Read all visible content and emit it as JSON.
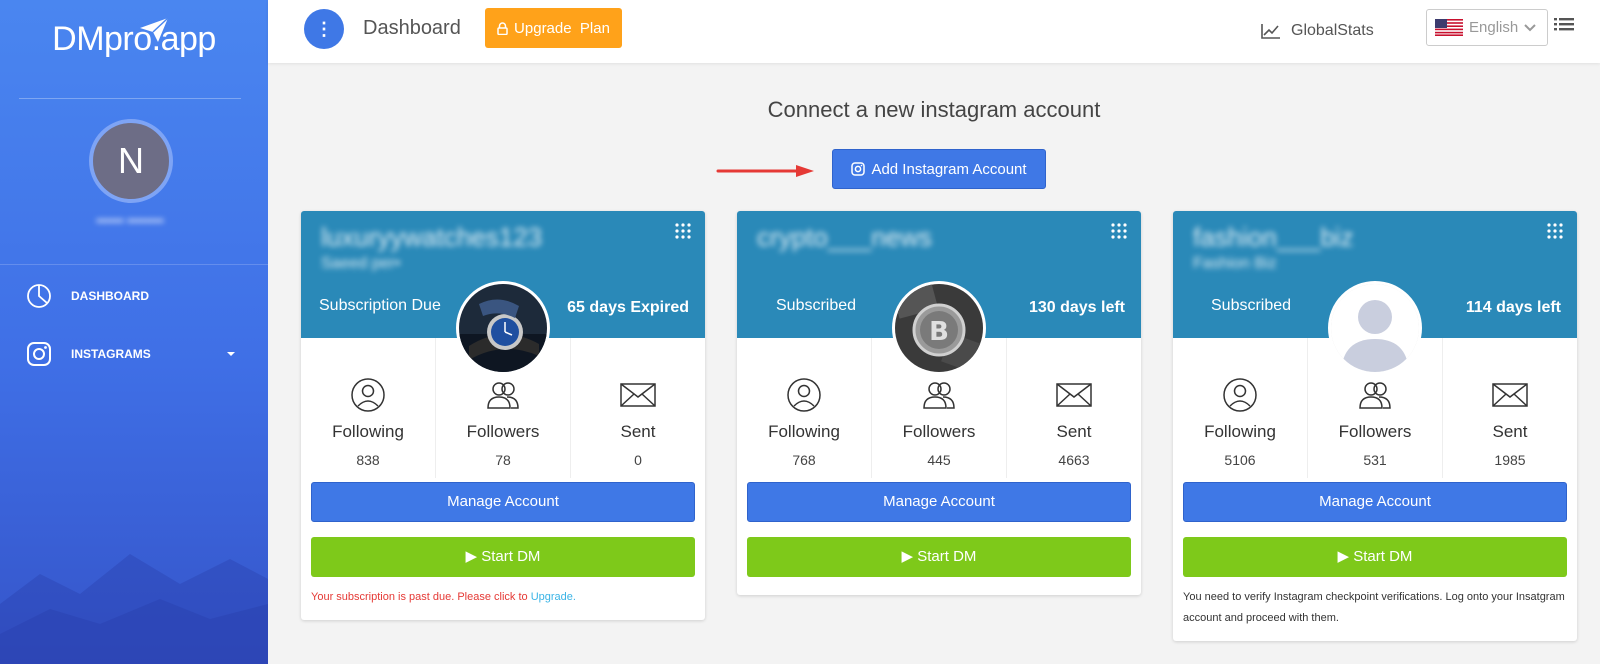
{
  "sidebar": {
    "brand": "DMpro.app",
    "avatar_letter": "N",
    "username": "•••••• ••••••••",
    "nav": [
      {
        "label": "DASHBOARD",
        "icon": "pie-chart-icon"
      },
      {
        "label": "INSTAGRAMS",
        "icon": "instagram-icon"
      }
    ]
  },
  "topbar": {
    "title": "Dashboard",
    "upgrade_label": "Upgrade  Plan",
    "globalstats_label": "GlobalStats",
    "language": "English"
  },
  "main": {
    "connect_title": "Connect a new instagram account",
    "add_button_label": "Add Instagram Account"
  },
  "cards": [
    {
      "name": "luxuryywatches123",
      "subtitle": "Saeed per•",
      "status": "Subscription Due",
      "days": "65 days Expired",
      "stats": {
        "following_label": "Following",
        "following": "838",
        "followers_label": "Followers",
        "followers": "78",
        "sent_label": "Sent",
        "sent": "0"
      },
      "manage_label": "Manage Account",
      "start_label": "▶ Start DM",
      "note": "Your subscription is past due. Please click to",
      "note_link": "Upgrade."
    },
    {
      "name": "crypto___news",
      "subtitle": "",
      "status": "Subscribed",
      "days": "130 days left",
      "stats": {
        "following_label": "Following",
        "following": "768",
        "followers_label": "Followers",
        "followers": "445",
        "sent_label": "Sent",
        "sent": "4663"
      },
      "manage_label": "Manage Account",
      "start_label": "▶ Start DM"
    },
    {
      "name": "fashion___biz",
      "subtitle": "Fashion Biz",
      "status": "Subscribed",
      "days": "114 days left",
      "stats": {
        "following_label": "Following",
        "following": "5106",
        "followers_label": "Followers",
        "followers": "531",
        "sent_label": "Sent",
        "sent": "1985"
      },
      "manage_label": "Manage Account",
      "start_label": "▶ Start DM",
      "note": "You need to verify Instagram checkpoint verifications. Log onto your Insatgram account and proceed with them."
    }
  ],
  "colors": {
    "sidebar": "#4a86f0",
    "primary": "#3f78e6",
    "upgrade": "#ffa21a",
    "card_header": "#2a89b8",
    "start_dm": "#7ec91a",
    "error": "#e53935",
    "link": "#3ab4e6"
  }
}
